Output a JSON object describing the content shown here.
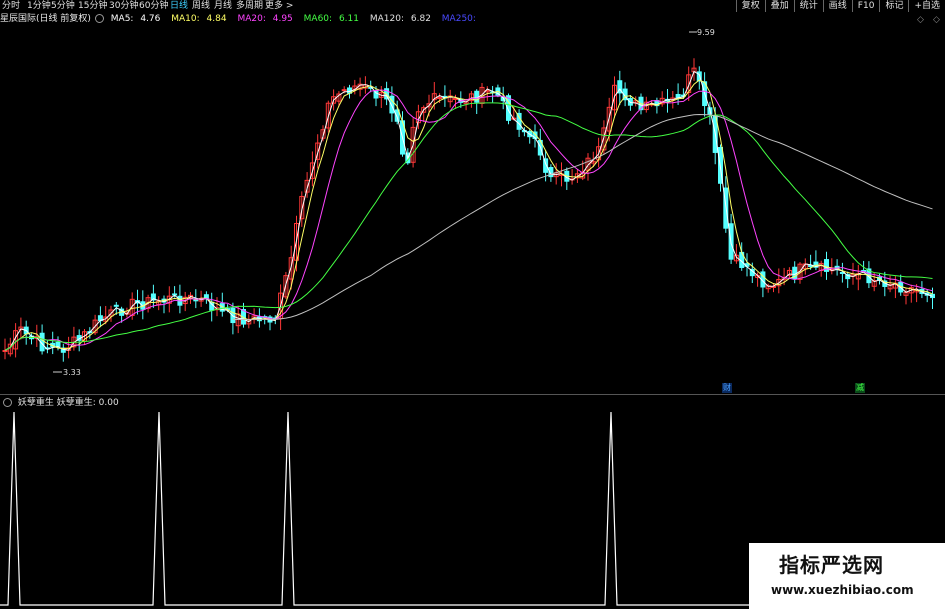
{
  "toolbar": {
    "periods": [
      "分时",
      "1分钟",
      "5分钟",
      "15分钟",
      "30分钟",
      "60分钟",
      "日线",
      "周线",
      "月线",
      "多周期",
      "更多 >"
    ],
    "active_period": "日线",
    "right_buttons": [
      "复权",
      "叠加",
      "统计",
      "画线",
      "F10",
      "标记",
      "+自选"
    ]
  },
  "stock": {
    "title": "星辰国际(日线 前复权)"
  },
  "ma": [
    {
      "label": "MA5:",
      "value": "4.76",
      "color": "#ffffff"
    },
    {
      "label": "MA10:",
      "value": "4.84",
      "color": "#ffff66"
    },
    {
      "label": "MA20:",
      "value": "4.95",
      "color": "#ff44ff"
    },
    {
      "label": "MA60:",
      "value": "6.11",
      "color": "#44ff44"
    },
    {
      "label": "MA120:",
      "value": "6.82",
      "color": "#c0c0c0"
    },
    {
      "label": "MA250:",
      "value": "",
      "color": "#4a4aff"
    }
  ],
  "chart": {
    "high_label": "9.59",
    "low_label": "3.33",
    "events": [
      "财",
      "减"
    ]
  },
  "indicator": {
    "name": "妖孽重生",
    "value_label": "妖孽重生: 0.00"
  },
  "watermark": {
    "title": "指标严选网",
    "url": "www.xuezhibiao.com"
  },
  "colors": {
    "up": "#ff3838",
    "down": "#54ffff",
    "bg": "#000000",
    "active": "#3fd0ff"
  },
  "icons": [
    "circle-icon",
    "diamond-icon"
  ]
}
